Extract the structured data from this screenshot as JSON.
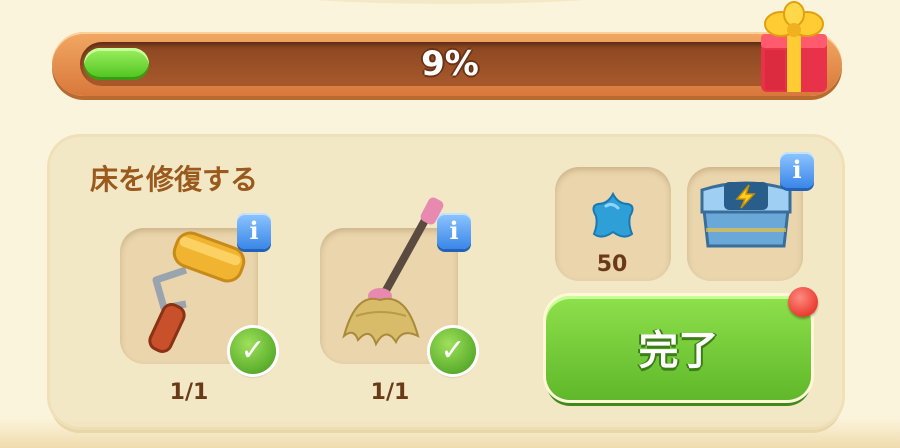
{
  "progress": {
    "percent": 9,
    "label": "9%"
  },
  "task": {
    "title": "床を修復する"
  },
  "tools": [
    {
      "name": "paint-roller",
      "count": "1/1",
      "done": true
    },
    {
      "name": "mop",
      "count": "1/1",
      "done": true
    }
  ],
  "rewards": [
    {
      "name": "blue-star",
      "amount": "50"
    },
    {
      "name": "energy-toolbox"
    }
  ],
  "info_glyph": "i",
  "check_glyph": "✓",
  "complete_button": {
    "label": "完了"
  },
  "colors": {
    "progress_fill": "#4cc21c",
    "progress_frame": "#d8783a",
    "button_green": "#5fb82a",
    "info_blue": "#3a86e8",
    "notification_red": "#e01e10",
    "title_brown": "#9a5a1e"
  }
}
